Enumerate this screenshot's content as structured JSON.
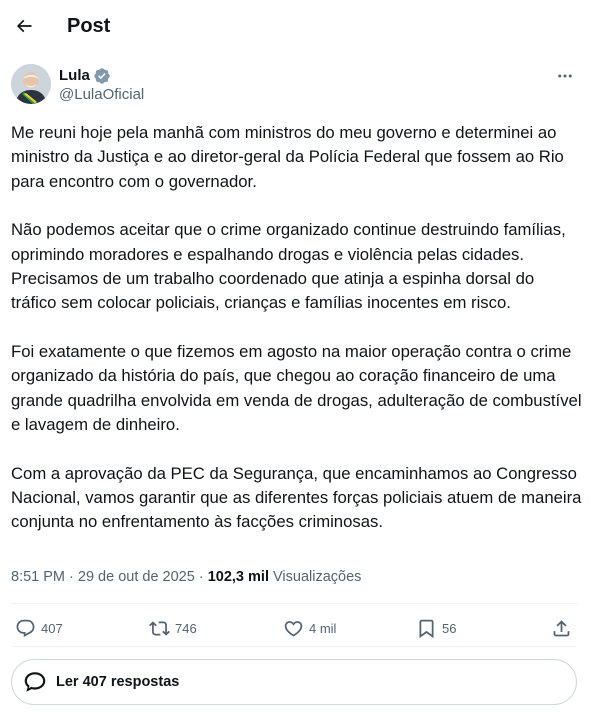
{
  "header": {
    "title": "Post"
  },
  "author": {
    "name": "Lula",
    "handle": "@LulaOficial"
  },
  "tweet": {
    "paragraphs": [
      "Me reuni hoje pela manhã com ministros do meu governo e determinei ao ministro da Justiça e ao diretor-geral da Polícia Federal que fossem ao Rio para encontro com o governador.",
      "Não podemos aceitar que o crime organizado continue destruindo famílias, oprimindo moradores e espalhando drogas e violência pelas cidades. Precisamos de um trabalho coordenado que atinja a espinha dorsal do tráfico sem colocar policiais, crianças e famílias inocentes em risco.",
      "Foi exatamente o que fizemos em agosto na maior operação contra o crime organizado da história do país, que chegou ao coração financeiro de uma grande quadrilha envolvida em venda de drogas, adulteração de combustível e lavagem de dinheiro.",
      "Com a aprovação da PEC da Segurança, que encaminhamos ao Congresso Nacional, vamos garantir que as diferentes forças policiais atuem de maneira conjunta no enfrentamento às facções criminosas."
    ]
  },
  "meta": {
    "time": "8:51 PM",
    "separator": " · ",
    "date": "29 de out de 2025",
    "views_count": "102,3 mil",
    "views_label": "Visualizações"
  },
  "actions": {
    "replies": "407",
    "reposts": "746",
    "likes": "4 mil",
    "bookmarks": "56"
  },
  "replies_link": {
    "label": "Ler 407 respostas"
  },
  "icons": [
    "back-arrow-icon",
    "verified-badge-icon",
    "more-icon",
    "reply-icon",
    "repost-icon",
    "like-icon",
    "bookmark-icon",
    "share-icon",
    "chat-bubble-icon"
  ],
  "colors": {
    "text": "#0f1419",
    "secondary": "#536471",
    "verified": "#829aab",
    "border": "#cfd9de",
    "divider": "#eff3f4"
  }
}
